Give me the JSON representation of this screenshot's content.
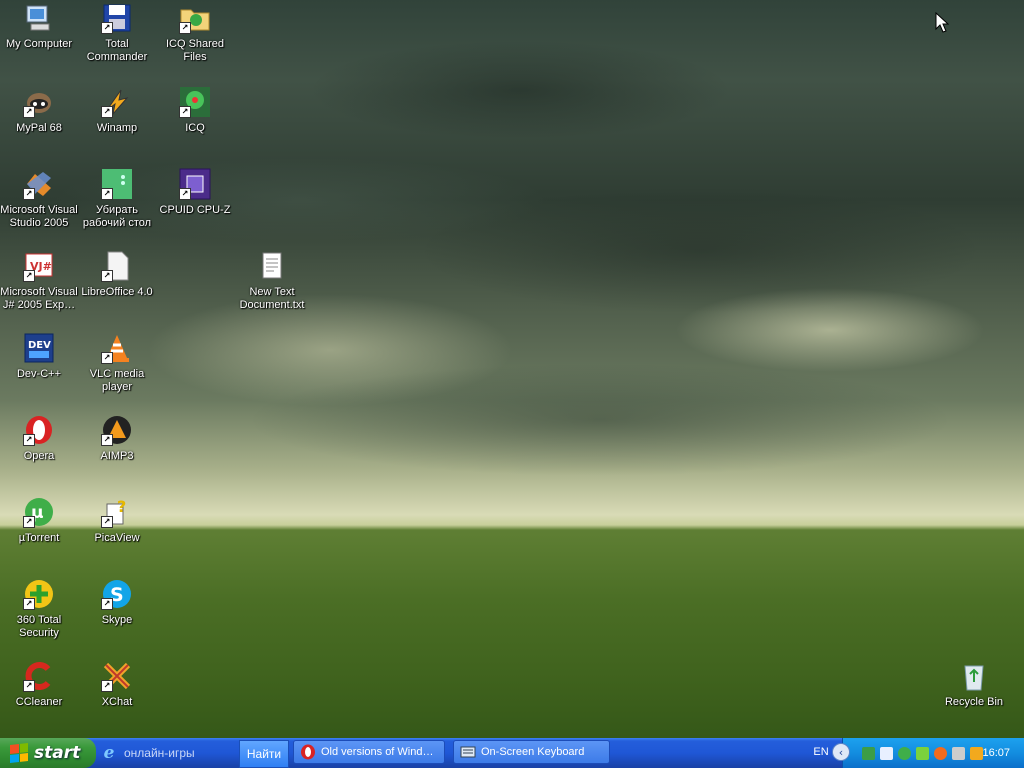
{
  "desktop": {
    "icons": [
      {
        "label": "My Computer",
        "icon": "my-computer-icon"
      },
      {
        "label": "Total Commander",
        "icon": "floppy-disk-icon"
      },
      {
        "label": "ICQ Shared Files",
        "icon": "shared-folder-icon"
      },
      {
        "label": "MyPal 68",
        "icon": "raccoon-icon"
      },
      {
        "label": "Winamp",
        "icon": "lightning-icon"
      },
      {
        "label": "ICQ",
        "icon": "icq-flower-icon"
      },
      {
        "label": "Microsoft Visual Studio 2005",
        "icon": "visual-studio-icon"
      },
      {
        "label": "Убирать рабочий стол",
        "icon": "green-board-icon"
      },
      {
        "label": "CPUID CPU-Z",
        "icon": "cpu-chip-icon"
      },
      {
        "label": "Microsoft Visual J# 2005 Exp…",
        "icon": "vj-icon"
      },
      {
        "label": "LibreOffice 4.0",
        "icon": "document-page-icon"
      },
      {
        "label": "New Text Document.txt",
        "icon": "text-file-icon"
      },
      {
        "label": "Dev-C++",
        "icon": "dev-cpp-icon"
      },
      {
        "label": "VLC media player",
        "icon": "traffic-cone-icon"
      },
      {
        "label": "Opera",
        "icon": "opera-o-icon"
      },
      {
        "label": "AIMP3",
        "icon": "aimp-triangle-icon"
      },
      {
        "label": "µTorrent",
        "icon": "utorrent-icon"
      },
      {
        "label": "PicaView",
        "icon": "question-doc-icon"
      },
      {
        "label": "360 Total Security",
        "icon": "plus-shield-icon"
      },
      {
        "label": "Skype",
        "icon": "skype-s-icon"
      },
      {
        "label": "CCleaner",
        "icon": "ccleaner-c-icon"
      },
      {
        "label": "XChat",
        "icon": "x-chat-icon"
      },
      {
        "label": "Recycle Bin",
        "icon": "recycle-bin-icon"
      }
    ]
  },
  "taskbar": {
    "start_label": "start",
    "quick_launch_text": "онлайн-игры",
    "search_button": "Найти",
    "tasks": [
      {
        "label": "Old versions of Wind…",
        "icon": "opera-o-icon"
      },
      {
        "label": "On-Screen Keyboard",
        "icon": "keyboard-icon"
      }
    ],
    "language": "EN",
    "tray_chevron": "‹",
    "clock": "16:07",
    "tray_icons": [
      "icq-tray-icon",
      "network-icon",
      "utorrent-tray-icon",
      "green-tray-icon",
      "security-tray-icon",
      "sound-icon",
      "winamp-tray-icon"
    ]
  },
  "colors": {
    "taskbar_blue": "#245edb",
    "start_green": "#3b9a3c",
    "tray_blue": "#138de0"
  }
}
